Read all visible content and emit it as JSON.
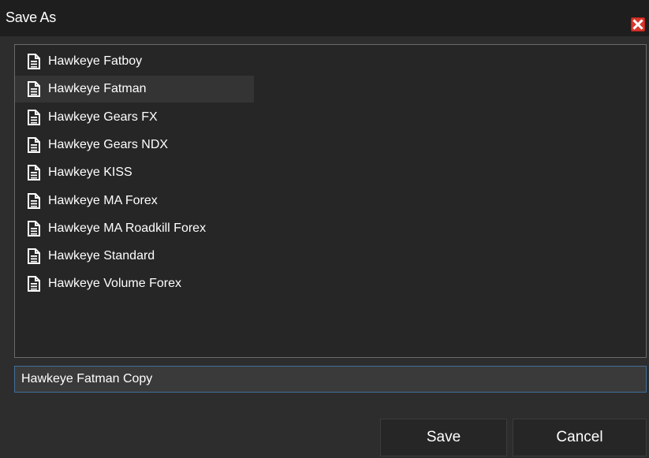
{
  "window": {
    "title": "Save As",
    "close_icon": "close-icon",
    "accent_color": "#d9362c"
  },
  "file_list": {
    "items": [
      {
        "label": "Hawkeye Fatboy",
        "icon": "document-icon",
        "selected": false
      },
      {
        "label": "Hawkeye Fatman",
        "icon": "document-icon",
        "selected": true
      },
      {
        "label": "Hawkeye Gears FX",
        "icon": "document-icon",
        "selected": false
      },
      {
        "label": "Hawkeye Gears NDX",
        "icon": "document-icon",
        "selected": false
      },
      {
        "label": "Hawkeye KISS",
        "icon": "document-icon",
        "selected": false
      },
      {
        "label": "Hawkeye MA Forex",
        "icon": "document-icon",
        "selected": false
      },
      {
        "label": "Hawkeye MA Roadkill Forex",
        "icon": "document-icon",
        "selected": false
      },
      {
        "label": "Hawkeye Standard",
        "icon": "document-icon",
        "selected": false
      },
      {
        "label": "Hawkeye Volume Forex",
        "icon": "document-icon",
        "selected": false
      }
    ]
  },
  "filename_input": {
    "value": "Hawkeye Fatman Copy"
  },
  "buttons": {
    "save_label": "Save",
    "cancel_label": "Cancel"
  }
}
